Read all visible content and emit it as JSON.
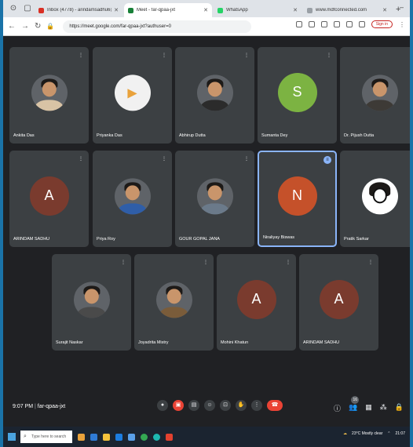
{
  "browser": {
    "tabs": [
      {
        "title": "Inbox (4778) - arindamsadhu6@...",
        "favicon_color": "#d93025",
        "active": false
      },
      {
        "title": "Meet - far-qpaa-jxt",
        "favicon_color": "#188038",
        "active": true
      },
      {
        "title": "WhatsApp",
        "favicon_color": "#25d366",
        "active": false
      },
      {
        "title": "www.mdfconnected.com",
        "favicon_color": "#9aa0a6",
        "active": false
      }
    ],
    "url": "https://meet.google.com/far-qpaa-jxt?authuser=0",
    "sign_in": "Sign in"
  },
  "meet": {
    "app_badge": "B",
    "clock": "9:07 PM",
    "meeting_code": "far-qpaa-jxt",
    "participant_count": "16",
    "participants": [
      {
        "name": "Ankita Das",
        "initial": "",
        "kind": "photo",
        "body": "#d8c3a5"
      },
      {
        "name": "Priyanka Das",
        "initial": "",
        "kind": "logo",
        "body": "#ffffff"
      },
      {
        "name": "Abhirup Dutta",
        "initial": "",
        "kind": "photo",
        "body": "#2b2b2b"
      },
      {
        "name": "Sumanta Dey",
        "initial": "S",
        "kind": "letter",
        "color": "#7cb342"
      },
      {
        "name": "Dr. Pijush Dutta",
        "initial": "",
        "kind": "photo",
        "body": "#3d3a36"
      },
      {
        "name": "ARINDAM SADHU",
        "initial": "A",
        "kind": "letter",
        "color": "#7a3b2e"
      },
      {
        "name": "Priya Roy",
        "initial": "",
        "kind": "photo",
        "body": "#2f5ea8"
      },
      {
        "name": "GOUR GOPAL JANA",
        "initial": "",
        "kind": "photo",
        "body": "#6b7a8a"
      },
      {
        "name": "Niraliyay Biswas",
        "initial": "N",
        "kind": "letter",
        "color": "#c5512a",
        "speaking": true
      },
      {
        "name": "Pratik Sarkar",
        "initial": "",
        "kind": "cartoon",
        "body": "#111111"
      },
      {
        "name": "Surajit Naskar",
        "initial": "",
        "kind": "photo",
        "body": "#4a4a4a"
      },
      {
        "name": "Joyadrita Mistry",
        "initial": "",
        "kind": "photo",
        "body": "#7a5c3a"
      },
      {
        "name": "Mohini Khatun",
        "initial": "A",
        "kind": "letter",
        "color": "#7a3b2e"
      },
      {
        "name": "ARINDAM SADHU",
        "initial": "A",
        "kind": "letter",
        "color": "#7a3b2e"
      }
    ]
  },
  "taskbar": {
    "search_placeholder": "Type here to search",
    "weather": "23°C Mostly clear",
    "time": "21:07"
  }
}
